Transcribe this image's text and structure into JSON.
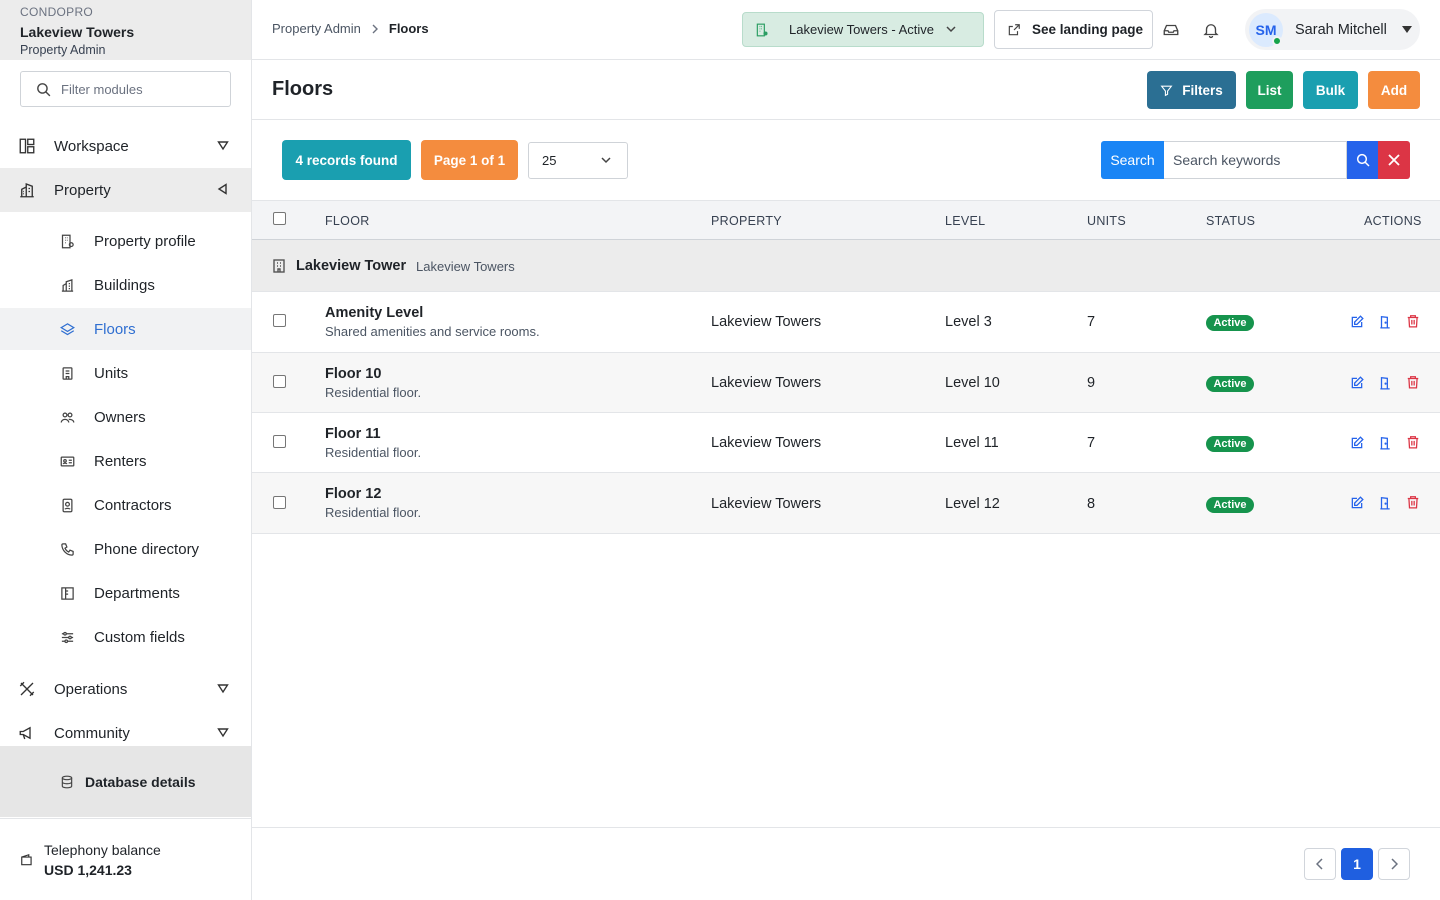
{
  "brand": {
    "app": "CONDOPRO",
    "property": "Lakeview Towers",
    "role": "Property Admin"
  },
  "sidebar": {
    "filter_placeholder": "Filter modules",
    "sections": [
      {
        "label": "Workspace",
        "icon": "layout-icon"
      },
      {
        "label": "Property",
        "icon": "building-icon"
      },
      {
        "label": "Operations",
        "icon": "tools-icon"
      },
      {
        "label": "Community",
        "icon": "megaphone-icon"
      }
    ],
    "items": [
      {
        "label": "Property profile",
        "icon": "building-settings-icon"
      },
      {
        "label": "Buildings",
        "icon": "buildings-icon"
      },
      {
        "label": "Floors",
        "icon": "layers-icon",
        "active": true
      },
      {
        "label": "Units",
        "icon": "unit-icon"
      },
      {
        "label": "Owners",
        "icon": "people-icon"
      },
      {
        "label": "Renters",
        "icon": "id-card-icon"
      },
      {
        "label": "Contractors",
        "icon": "badge-icon"
      },
      {
        "label": "Phone directory",
        "icon": "phone-icon"
      },
      {
        "label": "Departments",
        "icon": "departments-icon"
      },
      {
        "label": "Custom fields",
        "icon": "sliders-icon"
      }
    ],
    "database": "Database details",
    "balance_label": "Telephony balance",
    "balance_value": "USD 1,241.23"
  },
  "topbar": {
    "breadcrumb": [
      "Property Admin",
      "Floors"
    ],
    "property_select": "Lakeview Towers - Active",
    "landing": "See landing page",
    "user_initials": "SM",
    "user_name": "Sarah Mitchell"
  },
  "page": {
    "title": "Floors",
    "buttons": {
      "filters": "Filters",
      "list": "List",
      "bulk": "Bulk",
      "add": "Add"
    }
  },
  "toolbar": {
    "records": "4 records found",
    "page": "Page 1 of 1",
    "per_page": "25",
    "search_label": "Search",
    "search_placeholder": "Search keywords"
  },
  "table": {
    "columns": [
      "FLOOR",
      "PROPERTY",
      "LEVEL",
      "UNITS",
      "STATUS",
      "ACTIONS"
    ],
    "group": {
      "name": "Lakeview Tower",
      "sub": "Lakeview Towers"
    },
    "rows": [
      {
        "name": "Amenity Level",
        "desc": "Shared amenities and service rooms.",
        "property": "Lakeview Towers",
        "level": "Level 3",
        "units": "7",
        "status": "Active"
      },
      {
        "name": "Floor 10",
        "desc": "Residential floor.",
        "property": "Lakeview Towers",
        "level": "Level 10",
        "units": "9",
        "status": "Active"
      },
      {
        "name": "Floor 11",
        "desc": "Residential floor.",
        "property": "Lakeview Towers",
        "level": "Level 11",
        "units": "7",
        "status": "Active"
      },
      {
        "name": "Floor 12",
        "desc": "Residential floor.",
        "property": "Lakeview Towers",
        "level": "Level 12",
        "units": "8",
        "status": "Active"
      }
    ]
  },
  "pagination": {
    "current": "1"
  },
  "colors": {
    "accent": "#2563eb",
    "success": "#16944d",
    "teal": "#1a9fb0",
    "orange": "#f48c3e",
    "danger": "#dc3545"
  }
}
